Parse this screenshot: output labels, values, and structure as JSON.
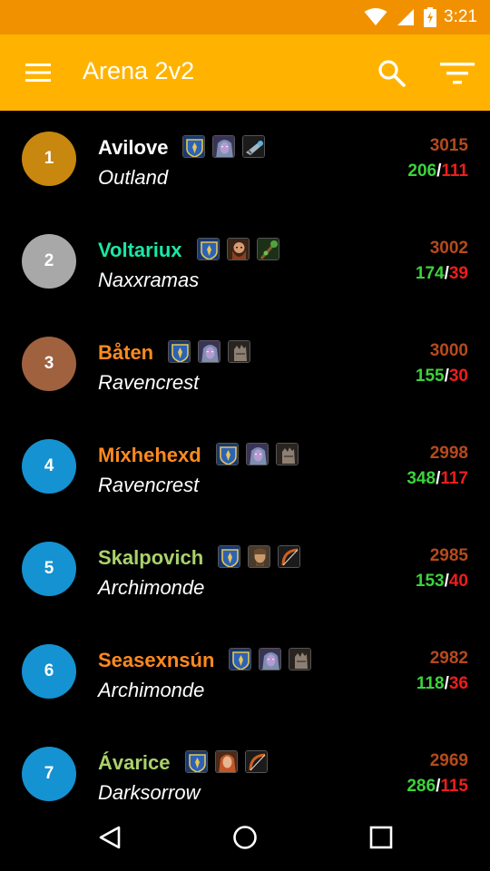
{
  "status_bar": {
    "time": "3:21",
    "icons": [
      "wifi-icon",
      "cell-signal-icon",
      "battery-charging-icon"
    ]
  },
  "app_bar": {
    "title": "Arena 2v2",
    "icons": [
      "menu-icon",
      "search-icon",
      "filter-icon"
    ]
  },
  "colors": {
    "status_bar": "#f29100",
    "app_bar": "#ffb300",
    "wins": "#3cd33c",
    "losses": "#ee1d1d",
    "rating": "#b54a1d",
    "rank_gold": "#c8870e",
    "rank_silver": "#a8a8a8",
    "rank_bronze": "#a0613f",
    "rank_default": "#1592d1"
  },
  "entries": [
    {
      "rank": "1",
      "rank_color": "#c8870e",
      "name": "Avilove",
      "name_color": "#ffffff",
      "realm": "Outland",
      "rating": "3015",
      "wins": "206",
      "losses": "111",
      "icons": [
        "alliance-crest-icon",
        "night-elf-female-icon",
        "hunter-gun-icon"
      ]
    },
    {
      "rank": "2",
      "rank_color": "#a8a8a8",
      "name": "Voltariux",
      "name_color": "#19e8a5",
      "realm": "Naxxramas",
      "rating": "3002",
      "wins": "174",
      "losses": "39",
      "icons": [
        "alliance-crest-icon",
        "dwarf-male-icon",
        "druid-staff-icon"
      ]
    },
    {
      "rank": "3",
      "rank_color": "#a0613f",
      "name": "Båten",
      "name_color": "#ff8a1e",
      "realm": "Ravencrest",
      "rating": "3000",
      "wins": "155",
      "losses": "30",
      "icons": [
        "alliance-crest-icon",
        "night-elf-female-icon",
        "warrior-gauntlet-icon"
      ]
    },
    {
      "rank": "4",
      "rank_color": "#1592d1",
      "name": "Míxhehexd",
      "name_color": "#ff8a1e",
      "realm": "Ravencrest",
      "rating": "2998",
      "wins": "348",
      "losses": "117",
      "icons": [
        "alliance-crest-icon",
        "night-elf-female-icon",
        "warrior-gauntlet-icon"
      ]
    },
    {
      "rank": "5",
      "rank_color": "#1592d1",
      "name": "Skalpovich",
      "name_color": "#a9d26b",
      "realm": "Archimonde",
      "rating": "2985",
      "wins": "153",
      "losses": "40",
      "icons": [
        "alliance-crest-icon",
        "human-male-icon",
        "hunter-bow-icon"
      ]
    },
    {
      "rank": "6",
      "rank_color": "#1592d1",
      "name": "Seasexnsún",
      "name_color": "#ff8a1e",
      "realm": "Archimonde",
      "rating": "2982",
      "wins": "118",
      "losses": "36",
      "icons": [
        "alliance-crest-icon",
        "night-elf-female-icon",
        "warrior-gauntlet-icon"
      ]
    },
    {
      "rank": "7",
      "rank_color": "#1592d1",
      "name": "Ávarice",
      "name_color": "#a9d26b",
      "realm": "Darksorrow",
      "rating": "2969",
      "wins": "286",
      "losses": "115",
      "icons": [
        "alliance-crest-icon",
        "human-female-icon",
        "hunter-bow-icon"
      ]
    }
  ],
  "nav_bar": {
    "icons": [
      "back-icon",
      "home-icon",
      "recents-icon"
    ]
  }
}
